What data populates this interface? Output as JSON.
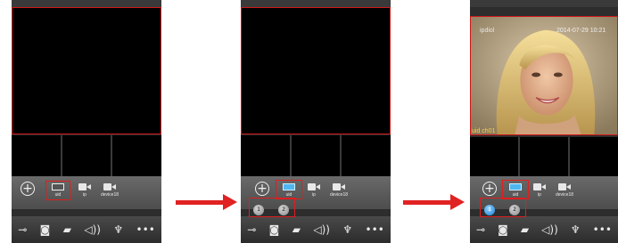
{
  "toolbar": {
    "devices": [
      {
        "label": "uid",
        "icon": "uid-device-icon"
      },
      {
        "label": "ip",
        "icon": "camera-icon"
      },
      {
        "label": "device18",
        "icon": "camera-icon"
      }
    ],
    "channels": [
      "1",
      "2"
    ]
  },
  "bottom_bar_icons": [
    "key-icon",
    "snapshot-icon",
    "record-icon",
    "speaker-icon",
    "microphone-icon",
    "more-icon"
  ],
  "video": {
    "top_left": "ipdiol",
    "timestamp": "2014-07-29 10:21",
    "channel_label": "uid ch01"
  },
  "colors": {
    "highlight": "#e01e1e",
    "selected": "#4fb6ef",
    "arrow": "#e02222"
  }
}
